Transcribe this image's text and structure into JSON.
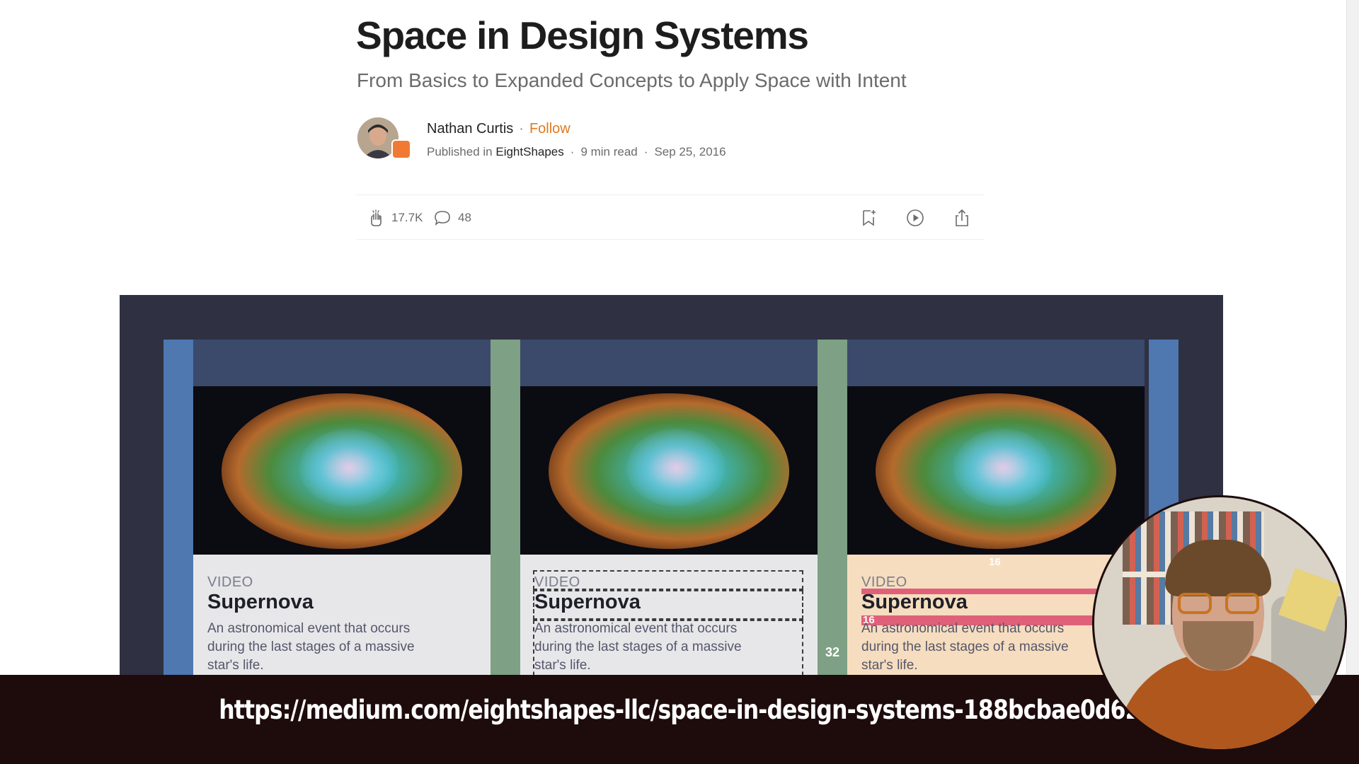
{
  "article": {
    "title": "Space in Design Systems",
    "subtitle": "From Basics to Expanded Concepts to Apply Space with Intent",
    "author": "Nathan Curtis",
    "follow_label": "Follow",
    "published_prefix": "Published in",
    "publication": "EightShapes",
    "read_time": "9 min read",
    "date": "Sep 25, 2016"
  },
  "actions": {
    "claps": "17.7K",
    "comments": "48",
    "icons": [
      "clap-icon",
      "comment-icon",
      "bookmark-add-icon",
      "play-icon",
      "share-icon"
    ]
  },
  "figure": {
    "card_kicker": "VIDEO",
    "card_title": "Supernova",
    "card_desc": "An astronomical event that occurs during the last stages of a massive star's life.",
    "gutter_value": "32",
    "padding_value": "16",
    "colors": {
      "background": "#2f3041",
      "header": "#3b4a6b",
      "gutter_blue": "#4f77b0",
      "gutter_green": "#7ea084",
      "highlight_pink": "#e0607a",
      "padding_tint": "#f6ddbf"
    }
  },
  "caption": {
    "url": "https://medium.com/eightshapes-llc/space-in-design-systems-188bcbae0d62"
  }
}
